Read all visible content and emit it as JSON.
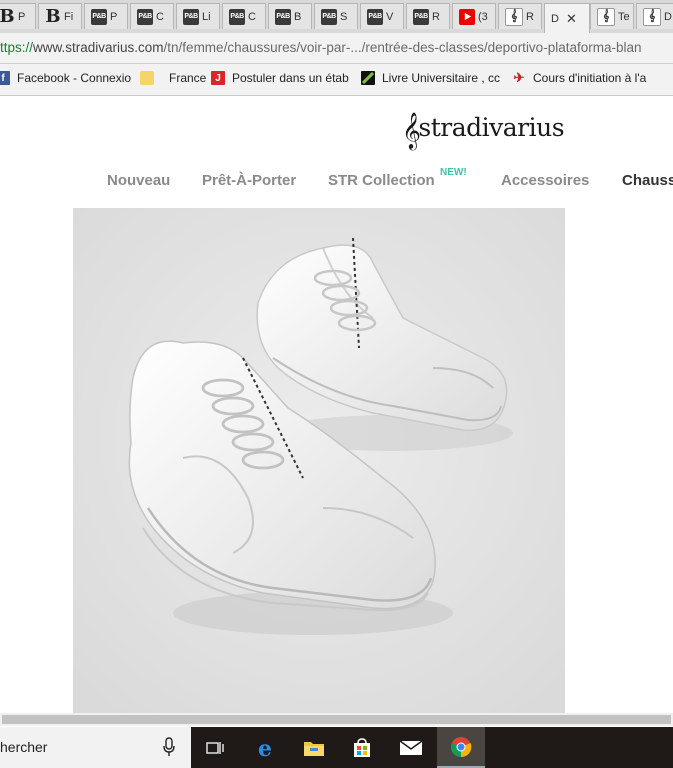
{
  "tabs": [
    {
      "icon": "b-icon",
      "title": "P"
    },
    {
      "icon": "b-icon",
      "title": "Fi"
    },
    {
      "icon": "pb-icon",
      "title": "P"
    },
    {
      "icon": "pb-icon",
      "title": "C"
    },
    {
      "icon": "pb-icon",
      "title": "Li"
    },
    {
      "icon": "pb-icon",
      "title": "C"
    },
    {
      "icon": "pb-icon",
      "title": "B"
    },
    {
      "icon": "pb-icon",
      "title": "S"
    },
    {
      "icon": "pb-icon",
      "title": "V"
    },
    {
      "icon": "pb-icon",
      "title": "R"
    },
    {
      "icon": "youtube-icon",
      "title": "(3"
    },
    {
      "icon": "stradivarius-icon",
      "title": "R"
    },
    {
      "icon": "stradivarius-icon",
      "title": "D",
      "active": true
    },
    {
      "icon": "stradivarius-icon",
      "title": "Te"
    },
    {
      "icon": "stradivarius-icon",
      "title": "D"
    }
  ],
  "address_bar": {
    "scheme": "ttps://",
    "host": "www.stradivarius.com",
    "path": "/tn/femme/chaussures/voir-par-.../rentrée-des-classes/deportivo-plataforma-blan"
  },
  "bookmarks": [
    {
      "label": "Facebook - Connexio",
      "icon": "facebook-icon"
    },
    {
      "label": "France",
      "icon": "folder-icon"
    },
    {
      "label": "Postuler dans un étab",
      "icon": "j-icon"
    },
    {
      "label": "Livre Universitaire , cc",
      "icon": "book-icon"
    },
    {
      "label": "Cours d'initiation à l'a",
      "icon": "walker-icon"
    }
  ],
  "site": {
    "logo_text": "stradivarius",
    "nav": [
      {
        "label": "Nouveau"
      },
      {
        "label": "Prêt-À-Porter"
      },
      {
        "label": "STR Collection",
        "badge": "NEW!"
      },
      {
        "label": "Accessoires"
      },
      {
        "label": "Chauss"
      }
    ]
  },
  "product": {
    "image": "white-chunky-sneakers"
  },
  "taskbar": {
    "search_text": "hercher",
    "apps": [
      "task-view-icon",
      "edge-icon",
      "file-explorer-icon",
      "store-icon",
      "mail-icon",
      "chrome-icon"
    ]
  },
  "colors": {
    "new_badge": "#3fc3a6",
    "taskbar": "#1f1a17",
    "nav_text": "#8a8a8a"
  }
}
